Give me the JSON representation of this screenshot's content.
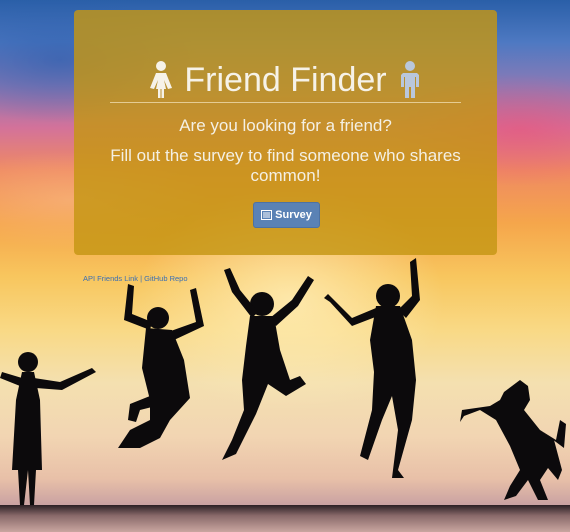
{
  "header": {
    "title": "Friend Finder",
    "left_icon": "female-person-icon",
    "right_icon": "male-person-icon"
  },
  "main": {
    "question": "Are you looking for a friend?",
    "instructions": "Fill out the survey to find someone who shares common!",
    "survey_button": {
      "label": "Survey",
      "icon": "list-alt-icon"
    }
  },
  "footer_links": {
    "api_link": "API Friends Link",
    "separator": "|",
    "github_link": "GitHub Repo"
  },
  "colors": {
    "panel": "#c49614",
    "button": "#5a82b5",
    "link": "#3b6fb3"
  }
}
